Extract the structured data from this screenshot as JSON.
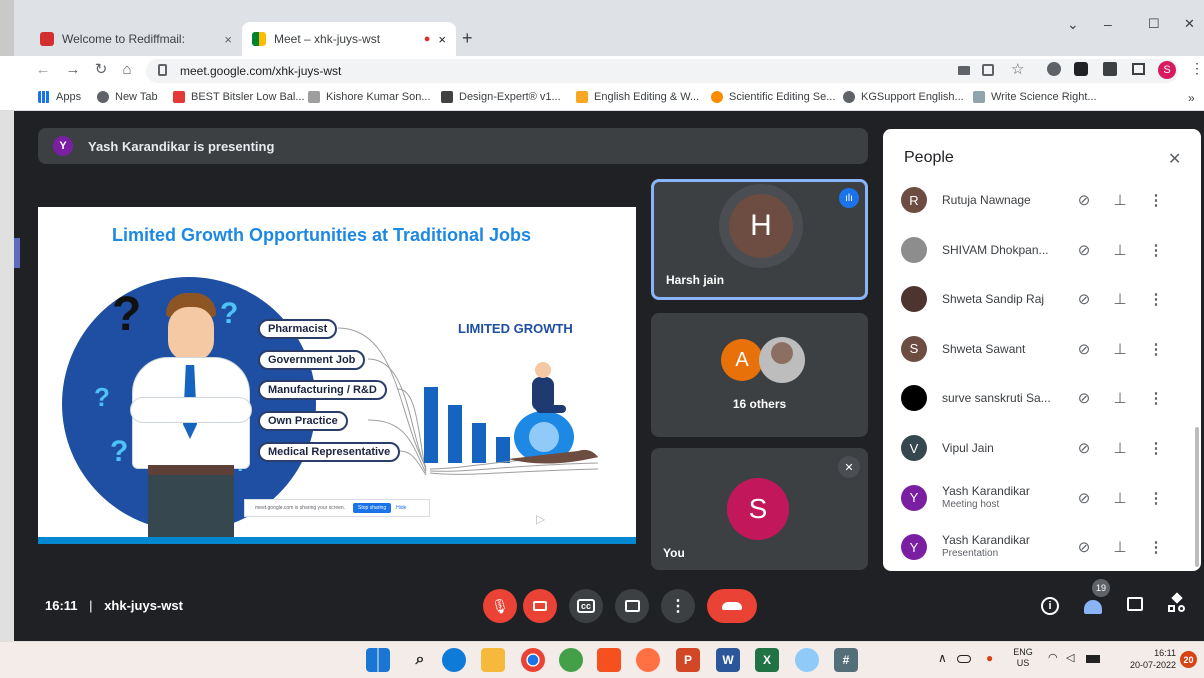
{
  "browser": {
    "tabs": [
      {
        "title": "Welcome to Rediffmail:",
        "close": "×"
      },
      {
        "title": "Meet – xhk-juys-wst",
        "close": "×",
        "recording": "●"
      }
    ],
    "new_tab": "+",
    "window_controls": {
      "chevron": "⌄",
      "minimize": "–",
      "maximize": "☐",
      "close": "✕"
    },
    "nav": {
      "back": "←",
      "forward": "→",
      "reload": "↻",
      "home": "⌂"
    },
    "url": "meet.google.com/xhk-juys-wst",
    "profile_initial": "S",
    "bookmarks": [
      "Apps",
      "New Tab",
      "BEST Bitsler Low Bal...",
      "Kishore Kumar Son...",
      "Design-Expert® v1...",
      "English Editing & W...",
      "Scientific Editing Se...",
      "KGSupport English...",
      "Write Science Right..."
    ],
    "bookmarks_more": "»"
  },
  "meet": {
    "presenting_initial": "Y",
    "presenting_text": "Yash Karandikar is presenting",
    "slide": {
      "title": "Limited Growth Opportunities at Traditional Jobs",
      "right_heading": "LIMITED GROWTH",
      "jobs": [
        "Pharmacist",
        "Government Job",
        "Manufacturing / R&D",
        "Own Practice",
        "Medical Representative"
      ],
      "share_notice": "meet.google.com is sharing your screen.",
      "stop_sharing": "Stop sharing",
      "hide": "Hide"
    },
    "tiles": [
      {
        "initial": "H",
        "name": "Harsh jain",
        "color": "#6d4c41"
      },
      {
        "initial": "A",
        "label": "16 others",
        "color": "#e8710a"
      },
      {
        "initial": "S",
        "name": "You",
        "color": "#c2185b"
      }
    ],
    "people_panel": {
      "title": "People",
      "close": "✕",
      "participants": [
        {
          "initial": "R",
          "name": "Rutuja Nawnage",
          "color": "#6d4c41"
        },
        {
          "initial": "",
          "name": "SHIVAM Dhokpan...",
          "color": "#8d8d8d"
        },
        {
          "initial": "",
          "name": "Shweta Sandip Raj",
          "color": "#4e342e"
        },
        {
          "initial": "S",
          "name": "Shweta Sawant",
          "color": "#6d4c41"
        },
        {
          "initial": "",
          "name": "surve sanskruti Sa...",
          "color": "#000000"
        },
        {
          "initial": "V",
          "name": "Vipul Jain",
          "color": "#37474f"
        },
        {
          "initial": "Y",
          "name": "Yash Karandikar",
          "sub": "Meeting host",
          "color": "#7b1fa2"
        },
        {
          "initial": "Y",
          "name": "Yash Karandikar",
          "sub": "Presentation",
          "color": "#7b1fa2"
        }
      ]
    },
    "bottom": {
      "time": "16:11",
      "separator": "|",
      "meeting_code": "xhk-juys-wst",
      "people_count": "19"
    }
  },
  "taskbar": {
    "lang": "ENG",
    "region": "US",
    "time": "16:11",
    "date": "20-07-2022",
    "notifications": "20"
  }
}
